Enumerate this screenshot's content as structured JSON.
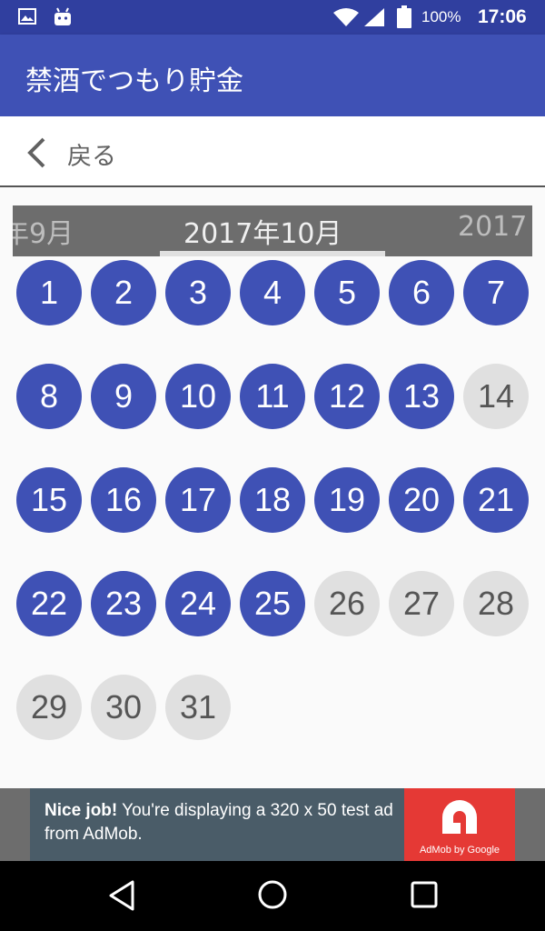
{
  "status_bar": {
    "battery": "100%",
    "time": "17:06",
    "icons": [
      "image-icon",
      "android-icon",
      "wifi-icon",
      "signal-icon",
      "battery-icon"
    ]
  },
  "app_bar": {
    "title": "禁酒でつもり貯金"
  },
  "back": {
    "label": "戻る"
  },
  "month_strip": {
    "prev": "年9月",
    "current": "2017年10月",
    "next": "2017"
  },
  "days": [
    {
      "label": "1",
      "done": true
    },
    {
      "label": "2",
      "done": true
    },
    {
      "label": "3",
      "done": true
    },
    {
      "label": "4",
      "done": true
    },
    {
      "label": "5",
      "done": true
    },
    {
      "label": "6",
      "done": true
    },
    {
      "label": "7",
      "done": true
    },
    {
      "label": "8",
      "done": true
    },
    {
      "label": "9",
      "done": true
    },
    {
      "label": "10",
      "done": true
    },
    {
      "label": "11",
      "done": true
    },
    {
      "label": "12",
      "done": true
    },
    {
      "label": "13",
      "done": true
    },
    {
      "label": "14",
      "done": false
    },
    {
      "label": "15",
      "done": true
    },
    {
      "label": "16",
      "done": true
    },
    {
      "label": "17",
      "done": true
    },
    {
      "label": "18",
      "done": true
    },
    {
      "label": "19",
      "done": true
    },
    {
      "label": "20",
      "done": true
    },
    {
      "label": "21",
      "done": true
    },
    {
      "label": "22",
      "done": true
    },
    {
      "label": "23",
      "done": true
    },
    {
      "label": "24",
      "done": true
    },
    {
      "label": "25",
      "done": true
    },
    {
      "label": "26",
      "done": false
    },
    {
      "label": "27",
      "done": false
    },
    {
      "label": "28",
      "done": false
    },
    {
      "label": "29",
      "done": false
    },
    {
      "label": "30",
      "done": false
    },
    {
      "label": "31",
      "done": false
    }
  ],
  "ad": {
    "headline": "Nice job!",
    "body": "You're displaying a 320 x 50 test ad from AdMob.",
    "brand": "AdMob by Google"
  },
  "colors": {
    "primary": "#3f51b5",
    "primary_dark": "#303f9f",
    "inactive_day": "#e0e0e0",
    "ad_red": "#e53935"
  },
  "nav_bar": {
    "buttons": [
      "back-triangle-icon",
      "home-circle-icon",
      "recents-square-icon"
    ]
  }
}
